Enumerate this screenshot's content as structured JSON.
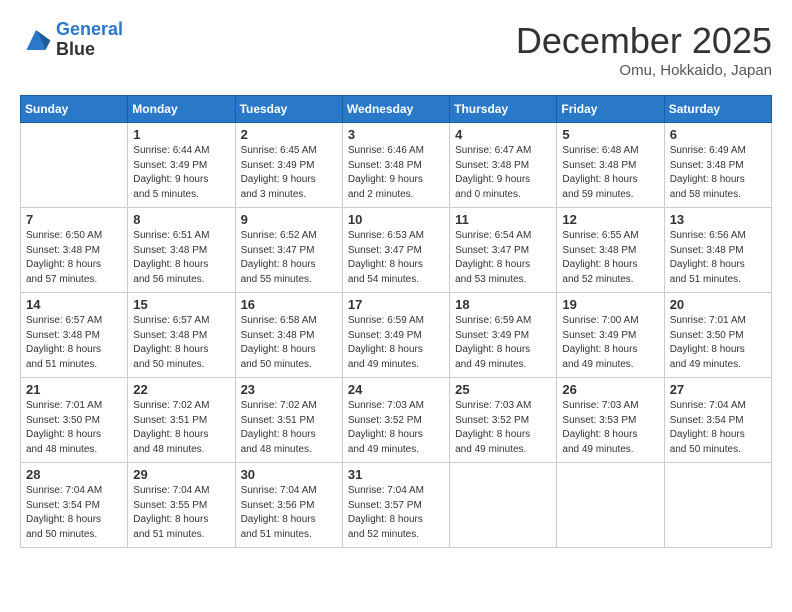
{
  "header": {
    "logo_line1": "General",
    "logo_line2": "Blue",
    "month": "December 2025",
    "location": "Omu, Hokkaido, Japan"
  },
  "weekdays": [
    "Sunday",
    "Monday",
    "Tuesday",
    "Wednesday",
    "Thursday",
    "Friday",
    "Saturday"
  ],
  "weeks": [
    [
      {
        "day": "",
        "info": ""
      },
      {
        "day": "1",
        "info": "Sunrise: 6:44 AM\nSunset: 3:49 PM\nDaylight: 9 hours\nand 5 minutes."
      },
      {
        "day": "2",
        "info": "Sunrise: 6:45 AM\nSunset: 3:49 PM\nDaylight: 9 hours\nand 3 minutes."
      },
      {
        "day": "3",
        "info": "Sunrise: 6:46 AM\nSunset: 3:48 PM\nDaylight: 9 hours\nand 2 minutes."
      },
      {
        "day": "4",
        "info": "Sunrise: 6:47 AM\nSunset: 3:48 PM\nDaylight: 9 hours\nand 0 minutes."
      },
      {
        "day": "5",
        "info": "Sunrise: 6:48 AM\nSunset: 3:48 PM\nDaylight: 8 hours\nand 59 minutes."
      },
      {
        "day": "6",
        "info": "Sunrise: 6:49 AM\nSunset: 3:48 PM\nDaylight: 8 hours\nand 58 minutes."
      }
    ],
    [
      {
        "day": "7",
        "info": "Sunrise: 6:50 AM\nSunset: 3:48 PM\nDaylight: 8 hours\nand 57 minutes."
      },
      {
        "day": "8",
        "info": "Sunrise: 6:51 AM\nSunset: 3:48 PM\nDaylight: 8 hours\nand 56 minutes."
      },
      {
        "day": "9",
        "info": "Sunrise: 6:52 AM\nSunset: 3:47 PM\nDaylight: 8 hours\nand 55 minutes."
      },
      {
        "day": "10",
        "info": "Sunrise: 6:53 AM\nSunset: 3:47 PM\nDaylight: 8 hours\nand 54 minutes."
      },
      {
        "day": "11",
        "info": "Sunrise: 6:54 AM\nSunset: 3:47 PM\nDaylight: 8 hours\nand 53 minutes."
      },
      {
        "day": "12",
        "info": "Sunrise: 6:55 AM\nSunset: 3:48 PM\nDaylight: 8 hours\nand 52 minutes."
      },
      {
        "day": "13",
        "info": "Sunrise: 6:56 AM\nSunset: 3:48 PM\nDaylight: 8 hours\nand 51 minutes."
      }
    ],
    [
      {
        "day": "14",
        "info": "Sunrise: 6:57 AM\nSunset: 3:48 PM\nDaylight: 8 hours\nand 51 minutes."
      },
      {
        "day": "15",
        "info": "Sunrise: 6:57 AM\nSunset: 3:48 PM\nDaylight: 8 hours\nand 50 minutes."
      },
      {
        "day": "16",
        "info": "Sunrise: 6:58 AM\nSunset: 3:48 PM\nDaylight: 8 hours\nand 50 minutes."
      },
      {
        "day": "17",
        "info": "Sunrise: 6:59 AM\nSunset: 3:49 PM\nDaylight: 8 hours\nand 49 minutes."
      },
      {
        "day": "18",
        "info": "Sunrise: 6:59 AM\nSunset: 3:49 PM\nDaylight: 8 hours\nand 49 minutes."
      },
      {
        "day": "19",
        "info": "Sunrise: 7:00 AM\nSunset: 3:49 PM\nDaylight: 8 hours\nand 49 minutes."
      },
      {
        "day": "20",
        "info": "Sunrise: 7:01 AM\nSunset: 3:50 PM\nDaylight: 8 hours\nand 49 minutes."
      }
    ],
    [
      {
        "day": "21",
        "info": "Sunrise: 7:01 AM\nSunset: 3:50 PM\nDaylight: 8 hours\nand 48 minutes."
      },
      {
        "day": "22",
        "info": "Sunrise: 7:02 AM\nSunset: 3:51 PM\nDaylight: 8 hours\nand 48 minutes."
      },
      {
        "day": "23",
        "info": "Sunrise: 7:02 AM\nSunset: 3:51 PM\nDaylight: 8 hours\nand 48 minutes."
      },
      {
        "day": "24",
        "info": "Sunrise: 7:03 AM\nSunset: 3:52 PM\nDaylight: 8 hours\nand 49 minutes."
      },
      {
        "day": "25",
        "info": "Sunrise: 7:03 AM\nSunset: 3:52 PM\nDaylight: 8 hours\nand 49 minutes."
      },
      {
        "day": "26",
        "info": "Sunrise: 7:03 AM\nSunset: 3:53 PM\nDaylight: 8 hours\nand 49 minutes."
      },
      {
        "day": "27",
        "info": "Sunrise: 7:04 AM\nSunset: 3:54 PM\nDaylight: 8 hours\nand 50 minutes."
      }
    ],
    [
      {
        "day": "28",
        "info": "Sunrise: 7:04 AM\nSunset: 3:54 PM\nDaylight: 8 hours\nand 50 minutes."
      },
      {
        "day": "29",
        "info": "Sunrise: 7:04 AM\nSunset: 3:55 PM\nDaylight: 8 hours\nand 51 minutes."
      },
      {
        "day": "30",
        "info": "Sunrise: 7:04 AM\nSunset: 3:56 PM\nDaylight: 8 hours\nand 51 minutes."
      },
      {
        "day": "31",
        "info": "Sunrise: 7:04 AM\nSunset: 3:57 PM\nDaylight: 8 hours\nand 52 minutes."
      },
      {
        "day": "",
        "info": ""
      },
      {
        "day": "",
        "info": ""
      },
      {
        "day": "",
        "info": ""
      }
    ]
  ]
}
